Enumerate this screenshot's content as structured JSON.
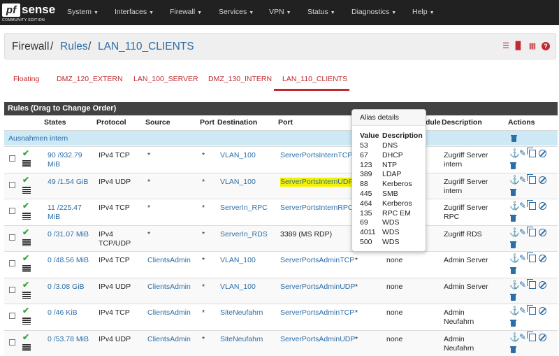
{
  "brand": {
    "name": "sense",
    "prefix": "pf",
    "edition": "COMMUNITY EDITION"
  },
  "nav": [
    "System",
    "Interfaces",
    "Firewall",
    "Services",
    "VPN",
    "Status",
    "Diagnostics",
    "Help"
  ],
  "breadcrumb": {
    "root": "Firewall",
    "section": "Rules",
    "current": "LAN_110_CLIENTS",
    "sep": "/"
  },
  "toolbar_icons": [
    "sliders-icon",
    "bar-chart-icon",
    "table-icon",
    "help-icon"
  ],
  "tabs": [
    "Floating",
    "DMZ_120_EXTERN",
    "LAN_100_SERVER",
    "DMZ_130_INTERN",
    "LAN_110_CLIENTS"
  ],
  "active_tab": "LAN_110_CLIENTS",
  "panel_title": "Rules (Drag to Change Order)",
  "columns": {
    "states": "States",
    "protocol": "Protocol",
    "source": "Source",
    "port": "Port",
    "destination": "Destination",
    "dport": "Port",
    "schedule": "dule",
    "description": "Description",
    "actions": "Actions"
  },
  "group_label": "Ausnahmen intern",
  "rows": [
    {
      "states": "90 /932.79 MiB",
      "protocol": "IPv4 TCP",
      "source": "*",
      "sport": "*",
      "destination": "VLAN_100",
      "dport": "ServerPortsInternTCP",
      "gateway": "",
      "schedule": "",
      "description": "Zugriff Server intern"
    },
    {
      "states": "49 /1.54 GiB",
      "protocol": "IPv4 UDP",
      "source": "*",
      "sport": "*",
      "destination": "VLAN_100",
      "dport": "ServerPortsInternUDP",
      "gateway": "",
      "schedule": "",
      "description": "Zugriff Server intern"
    },
    {
      "states": "11 /225.47 MiB",
      "protocol": "IPv4 TCP",
      "source": "*",
      "sport": "*",
      "destination": "ServerIn_RPC",
      "dport": "ServerPortsInternRPC",
      "gateway": "",
      "schedule": "",
      "description": "Zugriff Server RPC"
    },
    {
      "states": "0 /31.07 MiB",
      "protocol": "IPv4 TCP/UDP",
      "source": "*",
      "sport": "*",
      "destination": "ServerIn_RDS",
      "dport": "3389 (MS RDP)",
      "gateway": "",
      "schedule": "",
      "description": "Zugriff RDS"
    },
    {
      "states": "0 /48.56 MiB",
      "protocol": "IPv4 TCP",
      "source": "ClientsAdmin",
      "sport": "*",
      "destination": "VLAN_100",
      "dport": "ServerPortsAdminTCP",
      "gateway": "*",
      "schedule": "none",
      "description": "Admin Server"
    },
    {
      "states": "0 /3.08 GiB",
      "protocol": "IPv4 UDP",
      "source": "ClientsAdmin",
      "sport": "*",
      "destination": "VLAN_100",
      "dport": "ServerPortsAdminUDP",
      "gateway": "*",
      "schedule": "none",
      "description": "Admin Server"
    },
    {
      "states": "0 /46 KiB",
      "protocol": "IPv4 TCP",
      "source": "ClientsAdmin",
      "sport": "*",
      "destination": "SiteNeufahrn",
      "dport": "ServerPortsAdminTCP",
      "gateway": "*",
      "schedule": "none",
      "description": "Admin Neufahrn"
    },
    {
      "states": "0 /53.78 MiB",
      "protocol": "IPv4 UDP",
      "source": "ClientsAdmin",
      "sport": "*",
      "destination": "SiteNeufahrn",
      "dport": "ServerPortsAdminUDP",
      "gateway": "*",
      "schedule": "none",
      "description": "Admin Neufahrn"
    }
  ],
  "popover": {
    "title": "Alias details",
    "col_value": "Value",
    "col_description": "Description",
    "items": [
      {
        "value": "53",
        "description": "DNS"
      },
      {
        "value": "67",
        "description": "DHCP"
      },
      {
        "value": "123",
        "description": "NTP"
      },
      {
        "value": "389",
        "description": "LDAP"
      },
      {
        "value": "88",
        "description": "Kerberos"
      },
      {
        "value": "445",
        "description": "SMB"
      },
      {
        "value": "464",
        "description": "Kerberos"
      },
      {
        "value": "135",
        "description": "RPC EM"
      },
      {
        "value": "69",
        "description": "WDS"
      },
      {
        "value": "4011",
        "description": "WDS"
      },
      {
        "value": "500",
        "description": "WDS"
      }
    ]
  },
  "colors": {
    "brand_red": "#c0292e",
    "link_blue": "#2c6ea7",
    "navbar": "#212121",
    "group_bg": "#cde9f6",
    "highlight": "#f4f200"
  }
}
